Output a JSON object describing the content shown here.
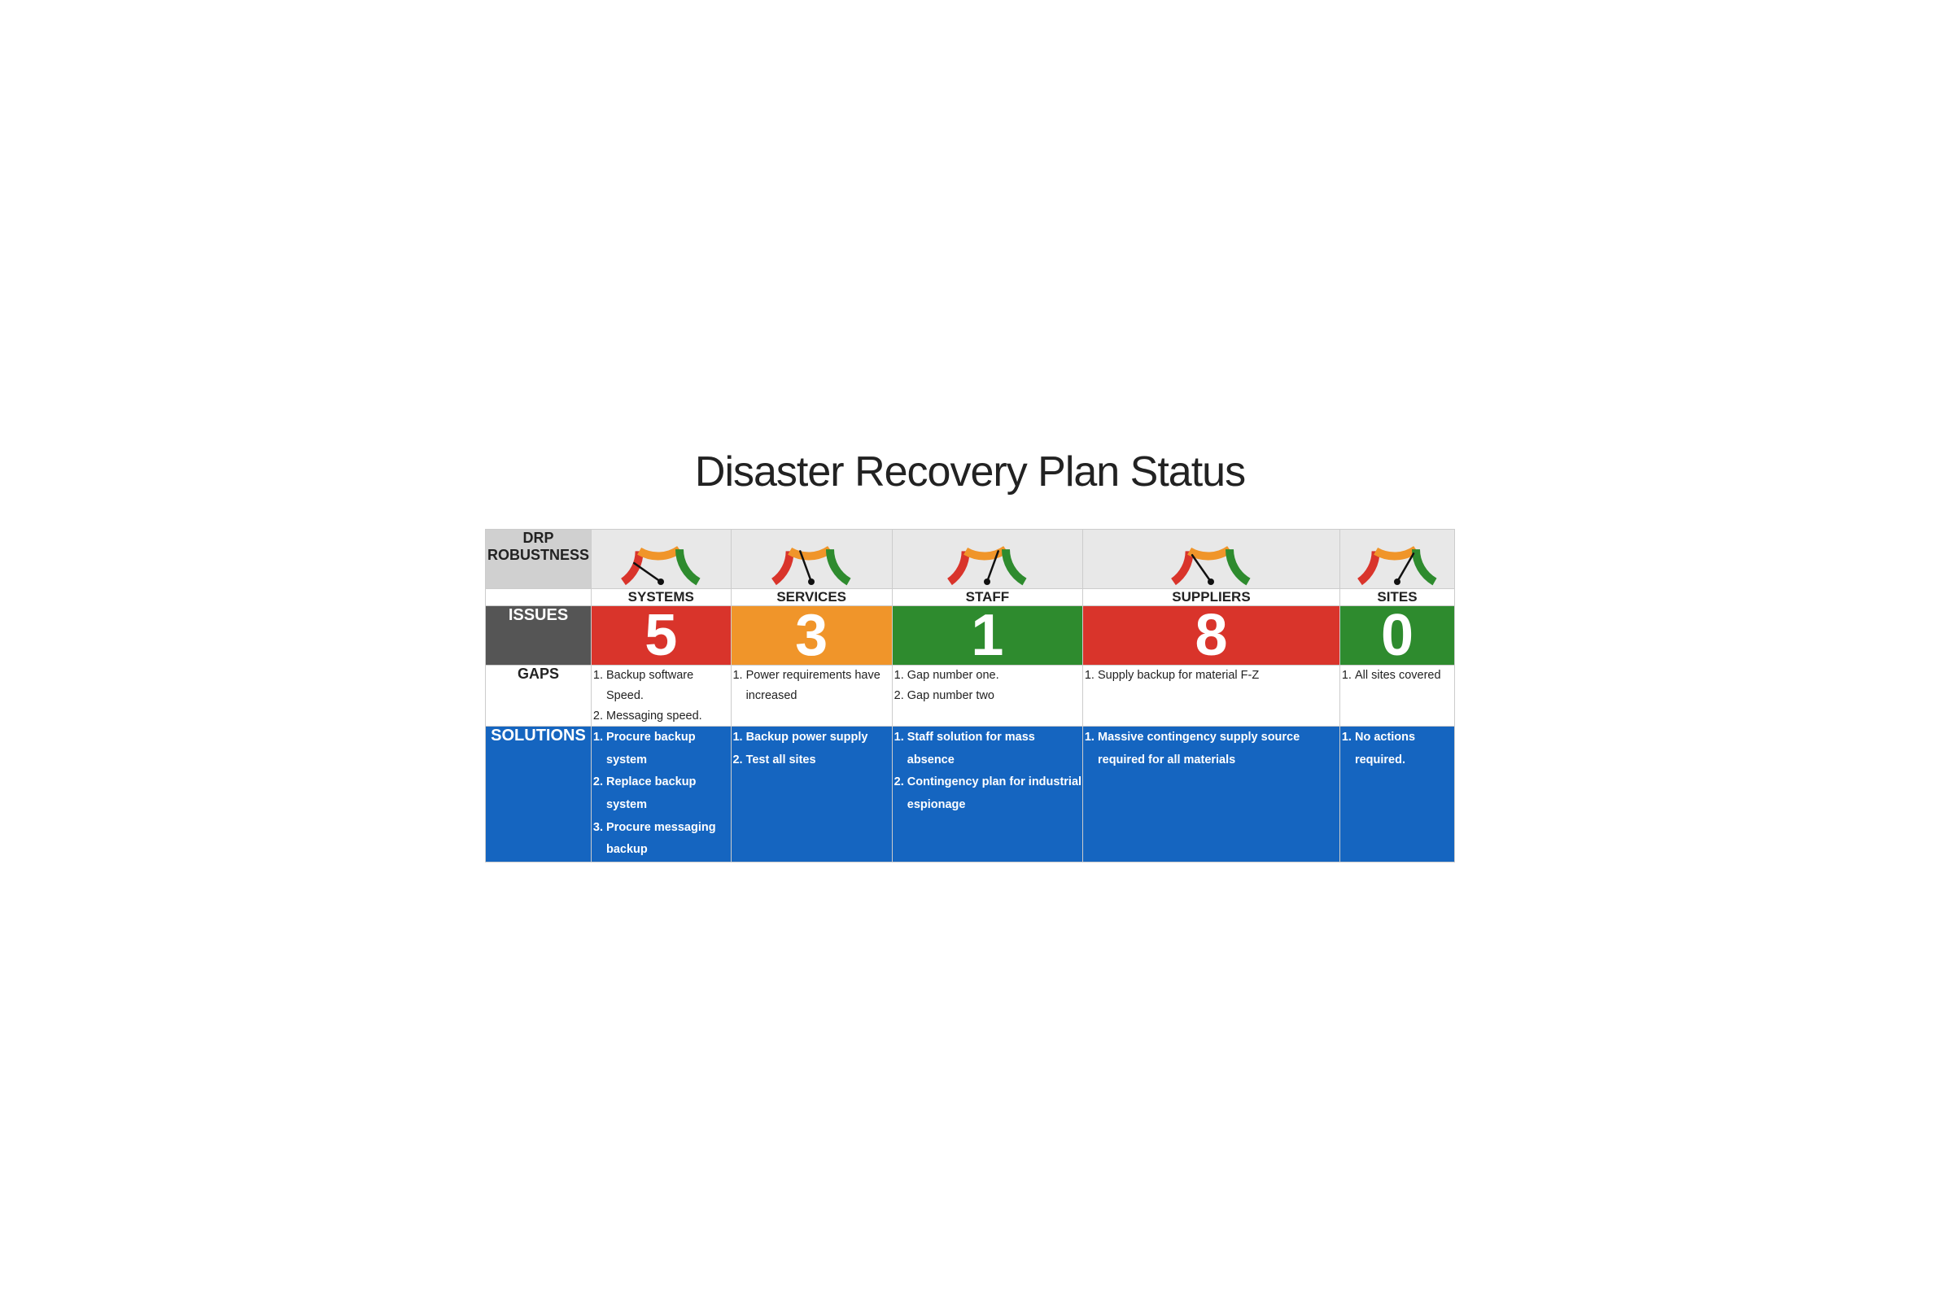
{
  "title": "Disaster Recovery Plan Status",
  "drp_label": "DRP\nROBUSTNESS",
  "columns": [
    {
      "id": "systems",
      "label": "SYSTEMS",
      "issues": "5",
      "issues_bg": "red",
      "gauge_needle_angle": -55,
      "gaps": [
        "Backup software Speed.",
        "Messaging speed."
      ],
      "solutions": [
        "Procure backup system",
        "Replace backup system",
        "Procure messaging backup"
      ]
    },
    {
      "id": "services",
      "label": "SERVICES",
      "issues": "3",
      "issues_bg": "orange",
      "gauge_needle_angle": -20,
      "gaps": [
        "Power requirements have increased"
      ],
      "solutions": [
        "Backup power supply",
        "Test all sites"
      ]
    },
    {
      "id": "staff",
      "label": "STAFF",
      "issues": "1",
      "issues_bg": "green",
      "gauge_needle_angle": 20,
      "gaps": [
        "Gap number one.",
        "Gap number two"
      ],
      "solutions": [
        "Staff solution for mass absence",
        "Contingency plan for industrial espionage"
      ]
    },
    {
      "id": "suppliers",
      "label": "SUPPLIERS",
      "issues": "8",
      "issues_bg": "red",
      "gauge_needle_angle": -35,
      "gaps": [
        "Supply backup for material F-Z"
      ],
      "solutions": [
        "Massive contingency supply source required for all materials"
      ]
    },
    {
      "id": "sites",
      "label": "SITES",
      "issues": "0",
      "issues_bg": "green",
      "gauge_needle_angle": 30,
      "gaps": [
        "All sites covered"
      ],
      "solutions": [
        "No actions required."
      ]
    }
  ],
  "row_labels": {
    "drp": "DRP ROBUSTNESS",
    "issues": "ISSUES",
    "gaps": "GAPS",
    "solutions": "SOLUTIONS"
  }
}
